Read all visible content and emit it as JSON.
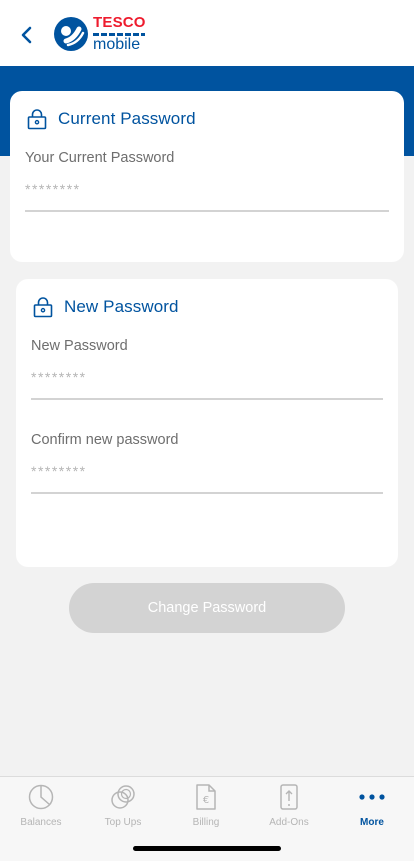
{
  "header": {
    "back_icon": "chevron-left-icon",
    "logo_brand": "TESCO",
    "logo_sub": "mobile"
  },
  "current_password": {
    "title": "Current Password",
    "field_label": "Your Current Password",
    "placeholder": "********"
  },
  "new_password": {
    "title": "New Password",
    "new_label": "New Password",
    "new_placeholder": "********",
    "confirm_label": "Confirm new password",
    "confirm_placeholder": "********"
  },
  "actions": {
    "change_label": "Change Password"
  },
  "tabbar": {
    "items": [
      {
        "label": "Balances",
        "icon": "pie-chart-icon"
      },
      {
        "label": "Top Ups",
        "icon": "coins-icon"
      },
      {
        "label": "Billing",
        "icon": "euro-document-icon"
      },
      {
        "label": "Add-Ons",
        "icon": "phone-arrow-icon"
      },
      {
        "label": "More",
        "icon": "more-dots-icon"
      }
    ],
    "active": "More"
  },
  "colors": {
    "brand_blue": "#00539f",
    "brand_red": "#ee1c2e",
    "disabled_button": "#d3d3d3"
  }
}
